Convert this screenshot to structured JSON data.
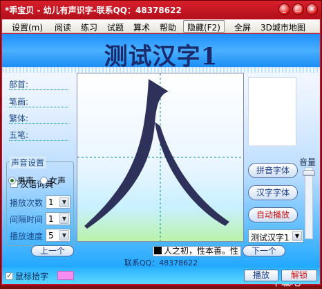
{
  "window": {
    "title": "*乖宝贝 - 幼儿有声识字-联系QQ：48378622",
    "controls": [
      "_",
      "□",
      "×"
    ]
  },
  "menu": [
    {
      "label": "设置(m)"
    },
    {
      "label": "阅读"
    },
    {
      "label": "练习"
    },
    {
      "label": "试题"
    },
    {
      "label": "算术"
    },
    {
      "label": "帮助"
    },
    {
      "label": "隐藏(F2)"
    },
    {
      "label": "全屏"
    },
    {
      "label": "3D城市地图"
    }
  ],
  "headline": "测试汉字1",
  "char_info": {
    "radical_label": "部首:",
    "strokes_label": "笔画:",
    "traditional_label": "繁体:",
    "wubi_label": "五笔:"
  },
  "dictionary": {
    "label": "汉语词典",
    "checked": false
  },
  "sound": {
    "group_title": "声音设置",
    "male": "男声",
    "female": "女声",
    "selected": "男声",
    "play_count_label": "播放次数",
    "play_count": "1",
    "interval_label": "间隔时间",
    "interval": "1",
    "speed_label": "播放速度",
    "speed": "5"
  },
  "glyph": {
    "character": "人",
    "stroke_color": "#2e3159"
  },
  "right_panel": {
    "pinyin_font": "拼音字体",
    "hanzi_font": "汉字字体",
    "autoplay": "自动播放",
    "volume_label": "音量",
    "volume_level": 0.95,
    "set_select": "测试汉字1"
  },
  "nav": {
    "prev": "上一个",
    "next": "下一个",
    "verse": "人之初，性本善。性"
  },
  "contact": "联系QQ：48378622",
  "bottom": {
    "mouse_pick": "鼠标拾字",
    "mouse_pick_checked": true,
    "play": "播放",
    "unlock": "解锁"
  },
  "watermark": "下载吧"
}
